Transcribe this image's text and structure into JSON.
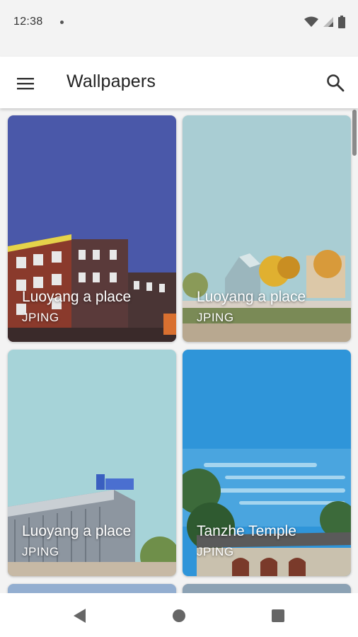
{
  "status_bar": {
    "time": "12:38",
    "icons": [
      "notification-dot-icon",
      "wifi-icon",
      "signal-icon",
      "battery-icon"
    ]
  },
  "app_bar": {
    "title": "Wallpapers",
    "menu_icon": "hamburger-menu-icon",
    "search_icon": "search-icon"
  },
  "wallpapers": [
    {
      "name": "Luoyang a place",
      "author": "JPING",
      "background": "#4a58a9"
    },
    {
      "name": "Luoyang a place",
      "author": "JPING",
      "background": "#a9cdd3"
    },
    {
      "name": "Luoyang a place",
      "author": "JPING",
      "background": "#a6d3d8"
    },
    {
      "name": "Tanzhe Temple",
      "author": "JPING",
      "background": "#2f95d9"
    }
  ],
  "nav_bar": {
    "icons": [
      "back-icon",
      "home-icon",
      "recents-icon"
    ]
  }
}
